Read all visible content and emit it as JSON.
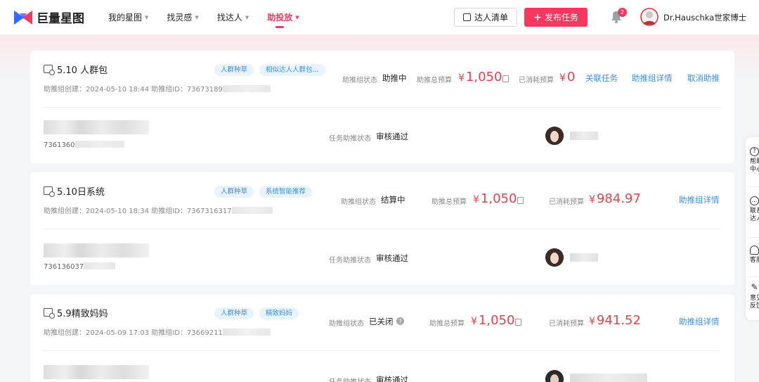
{
  "header": {
    "logo_text": "巨量星图",
    "nav": [
      {
        "label": "我的星图"
      },
      {
        "label": "找灵感"
      },
      {
        "label": "找达人"
      },
      {
        "label": "助投放",
        "active": true
      }
    ],
    "talent_list_label": "达人清单",
    "publish_label": "发布任务",
    "notification_count": "2",
    "username": "Dr.Hauschka世家博士"
  },
  "colors": {
    "brand": "#f5385e",
    "link": "#3b8ee0",
    "money": "#e8414b",
    "tag_bg": "#e8f3fc"
  },
  "labels": {
    "group_status": "助推组状态",
    "total_budget": "助推总预算",
    "consumed_budget": "已消耗预算",
    "task_status": "任务助推状态",
    "yen": "¥"
  },
  "groups": [
    {
      "title": "5.10 人群包",
      "tags": [
        "人群种草",
        "相似达人人群包..."
      ],
      "meta": "助推组创建：2024-05-10 18:44  助推组ID：73673189",
      "status": "助推中",
      "total_budget": "1,050",
      "consumed": "0",
      "links": [
        "关联任务",
        "助推组详情",
        "取消助推"
      ],
      "task": {
        "id_prefix": "7361360",
        "task_status": "审核通过"
      }
    },
    {
      "title": "5.10日系统",
      "tags": [
        "人群种草",
        "系统智能推荐"
      ],
      "meta": "助推组创建：2024-05-10 18:34  助推组ID：7367316317",
      "status": "结算中",
      "total_budget": "1,050",
      "consumed": "984.97",
      "links": [
        "助推组详情"
      ],
      "task": {
        "id_prefix": "736136037",
        "task_status": "审核通过"
      }
    },
    {
      "title": "5.9精致妈妈",
      "tags": [
        "人群种草",
        "精致妈妈"
      ],
      "meta": "助推组创建：2024-05-09 17:03  助推组ID：73669211",
      "status": "已关闭",
      "total_budget": "1,050",
      "consumed": "941.52",
      "links": [
        "助推组详情"
      ],
      "task": {
        "id_prefix": "",
        "task_status": "审核通过"
      }
    }
  ],
  "side_panel": [
    {
      "icon": "help-icon",
      "label": "帮助中心"
    },
    {
      "icon": "chat-icon",
      "label": "联系达人"
    },
    {
      "icon": "headset-icon",
      "label": "客服"
    },
    {
      "icon": "edit-icon",
      "label": "意见反馈"
    }
  ]
}
